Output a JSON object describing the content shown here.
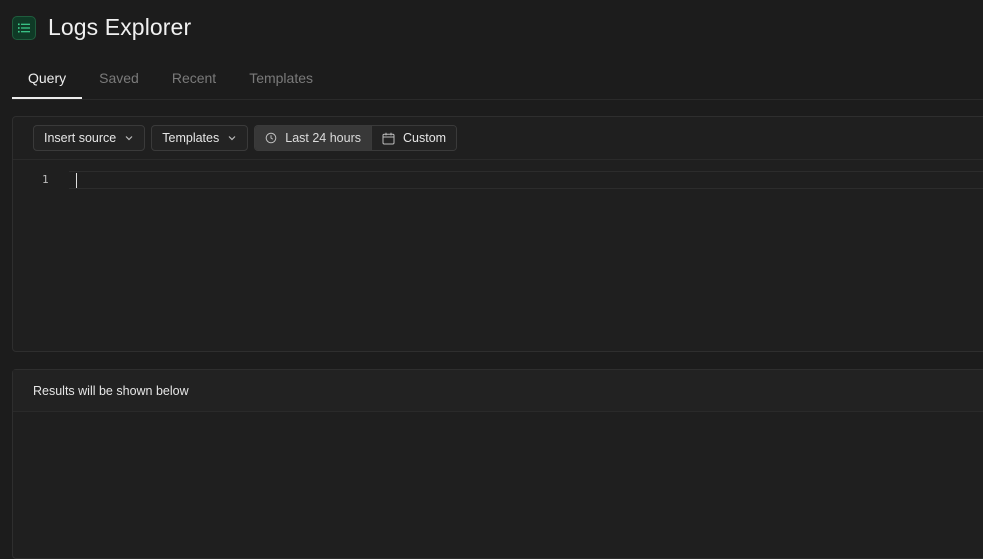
{
  "header": {
    "title": "Logs Explorer",
    "icon": "list-icon",
    "accent_color": "#3ecf8e"
  },
  "tabs": [
    {
      "label": "Query",
      "active": true
    },
    {
      "label": "Saved",
      "active": false
    },
    {
      "label": "Recent",
      "active": false
    },
    {
      "label": "Templates",
      "active": false
    }
  ],
  "toolbar": {
    "insert_source_label": "Insert source",
    "templates_label": "Templates",
    "time_range_label": "Last 24 hours",
    "custom_label": "Custom"
  },
  "editor": {
    "line_number": "1",
    "content": ""
  },
  "results": {
    "header_text": "Results will be shown below"
  }
}
